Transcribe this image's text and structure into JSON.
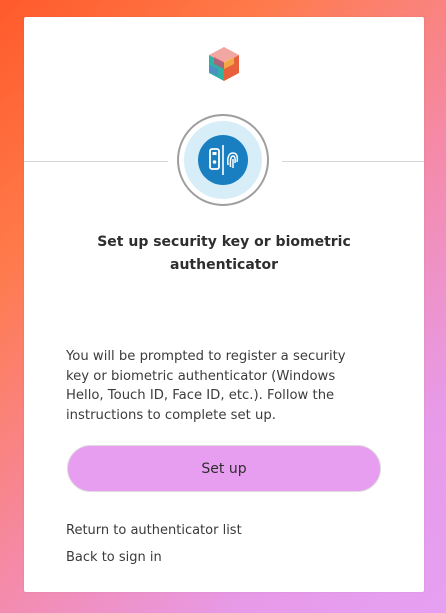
{
  "card": {
    "title": "Set up security key or biometric authenticator",
    "description": "You will be prompted to register a security key or biometric authenticator (Windows Hello, Touch ID, Face ID, etc.). Follow the instructions to complete set up.",
    "setup_button_label": "Set up",
    "return_link_label": "Return to authenticator list",
    "back_link_label": "Back to sign in"
  },
  "icons": {
    "logo": "brand-logo-icon",
    "authenticator": "security-key-fingerprint-icon"
  },
  "colors": {
    "button": "#e89ef0",
    "badge_core": "#1a7fc1",
    "badge_ring_fill": "#d7eef9"
  }
}
